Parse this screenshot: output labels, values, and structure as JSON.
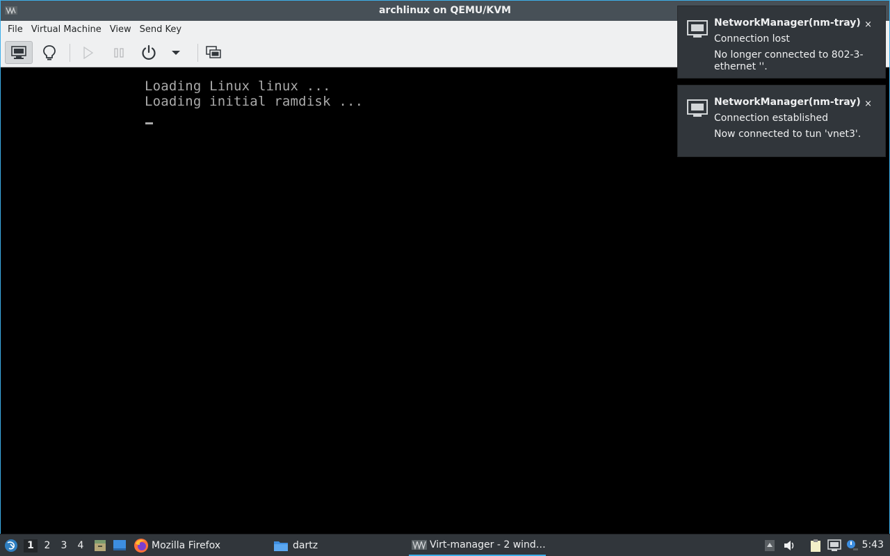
{
  "window": {
    "title": "archlinux on QEMU/KVM",
    "icon": "virt-manager-icon"
  },
  "menubar": {
    "items": [
      "File",
      "Virtual Machine",
      "View",
      "Send Key"
    ]
  },
  "toolbar": {
    "buttons": [
      {
        "name": "console-view-button",
        "icon": "monitor-icon",
        "active": true
      },
      {
        "name": "details-view-button",
        "icon": "lightbulb-icon",
        "active": false
      },
      {
        "name": "run-button",
        "icon": "play-icon",
        "enabled": false
      },
      {
        "name": "pause-button",
        "icon": "pause-icon",
        "enabled": false
      },
      {
        "name": "shutdown-button",
        "icon": "power-icon",
        "enabled": true
      },
      {
        "name": "shutdown-menu-button",
        "icon": "chevron-down-icon",
        "enabled": true
      },
      {
        "name": "fullscreen-button",
        "icon": "fullscreen-icon",
        "enabled": true
      }
    ]
  },
  "console": {
    "lines": [
      "Loading Linux linux ...",
      "Loading initial ramdisk ..."
    ]
  },
  "notifications": [
    {
      "app": "NetworkManager(nm-tray)",
      "summary": "Connection lost",
      "body": "No longer connected to 802-3-ethernet ''.",
      "close": "×"
    },
    {
      "app": "NetworkManager(nm-tray)",
      "summary": "Connection established",
      "body": "Now connected to tun 'vnet3'.",
      "close": "×"
    }
  ],
  "taskbar": {
    "desktops": [
      "1",
      "2",
      "3",
      "4"
    ],
    "active_desktop": "1",
    "tasks": [
      {
        "label": "Mozilla Firefox",
        "icon": "firefox-icon"
      },
      {
        "label": "dartz",
        "icon": "folder-icon"
      },
      {
        "label": "Virt-manager - 2 wind…",
        "icon": "virt-manager-icon",
        "active": true
      }
    ],
    "clock": "5:43"
  },
  "colors": {
    "accent": "#3daee9",
    "panel": "#31363b",
    "console_text": "#aaaaaa"
  }
}
